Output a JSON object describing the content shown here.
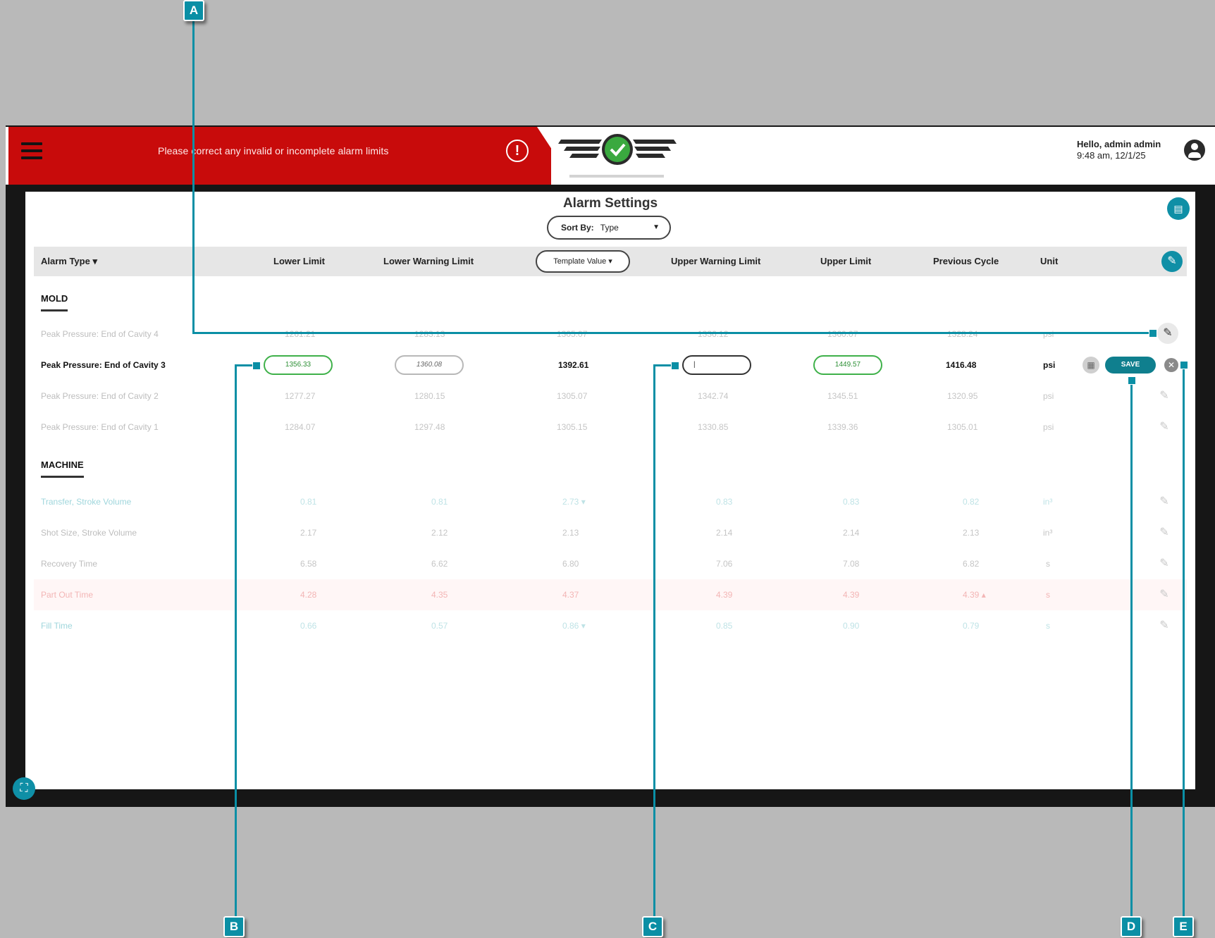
{
  "banner": {
    "message": "Please correct any invalid or incomplete alarm limits"
  },
  "user": {
    "greeting": "Hello, admin admin",
    "datetime": "9:48 am, 12/1/25"
  },
  "panel": {
    "title": "Alarm Settings",
    "sort_label": "Sort By:",
    "sort_value": "Type"
  },
  "columns": {
    "alarm_type": "Alarm Type",
    "lower_limit": "Lower Limit",
    "lower_warning": "Lower Warning Limit",
    "template_value": "Template Value",
    "upper_warning": "Upper Warning Limit",
    "upper_limit": "Upper Limit",
    "previous_cycle": "Previous Cycle",
    "unit": "Unit"
  },
  "sections": {
    "mold": "MOLD",
    "machine": "MACHINE"
  },
  "mold_rows": [
    {
      "name": "Peak Pressure: End of Cavity 4",
      "ll": "1261.21",
      "lwl": "1283.13",
      "tv": "1305.07",
      "uwl": "1336.12",
      "ul": "1360.07",
      "pc": "1328.24",
      "unit": "psi"
    },
    {
      "name": "Peak Pressure: End of Cavity 3",
      "ll": "1356.33",
      "lwl": "1360.08",
      "tv": "1392.61",
      "uwl": "|",
      "ul": "1449.57",
      "pc": "1416.48",
      "unit": "psi",
      "save": "SAVE"
    },
    {
      "name": "Peak Pressure: End of Cavity 2",
      "ll": "1277.27",
      "lwl": "1280.15",
      "tv": "1305.07",
      "uwl": "1342.74",
      "ul": "1345.51",
      "pc": "1320.95",
      "unit": "psi"
    },
    {
      "name": "Peak Pressure: End of Cavity 1",
      "ll": "1284.07",
      "lwl": "1297.48",
      "tv": "1305.15",
      "uwl": "1330.85",
      "ul": "1339.36",
      "pc": "1305.01",
      "unit": "psi"
    }
  ],
  "machine_rows": [
    {
      "name": "Transfer, Stroke Volume",
      "ll": "0.81",
      "lwl": "0.81",
      "tv": "2.73 ▾",
      "uwl": "0.83",
      "ul": "0.83",
      "pc": "0.82",
      "unit": "in³",
      "style": "teal"
    },
    {
      "name": "Shot Size, Stroke Volume",
      "ll": "2.17",
      "lwl": "2.12",
      "tv": "2.13",
      "uwl": "2.14",
      "ul": "2.14",
      "pc": "2.13",
      "unit": "in³",
      "style": "faded"
    },
    {
      "name": "Recovery Time",
      "ll": "6.58",
      "lwl": "6.62",
      "tv": "6.80",
      "uwl": "7.06",
      "ul": "7.08",
      "pc": "6.82",
      "unit": "s",
      "style": "faded"
    },
    {
      "name": "Part Out Time",
      "ll": "4.28",
      "lwl": "4.35",
      "tv": "4.37",
      "uwl": "4.39",
      "ul": "4.39",
      "pc": "4.39 ▴",
      "unit": "s",
      "style": "red"
    },
    {
      "name": "Fill Time",
      "ll": "0.66",
      "lwl": "0.57",
      "tv": "0.86 ▾",
      "uwl": "0.85",
      "ul": "0.90",
      "pc": "0.79",
      "unit": "s",
      "style": "teal"
    }
  ],
  "callouts": {
    "a": "A",
    "b": "B",
    "c": "C",
    "d": "D",
    "e": "E"
  },
  "colors": {
    "banner_red": "#c80b0b",
    "accent_teal": "#0f8fa6",
    "valid_green": "#3fb14a"
  },
  "icons": [
    "menu-icon",
    "alert-icon",
    "logo-check-icon",
    "user-icon",
    "grid-icon",
    "pencil-icon",
    "calculator-icon",
    "close-icon",
    "fullscreen-icon"
  ]
}
